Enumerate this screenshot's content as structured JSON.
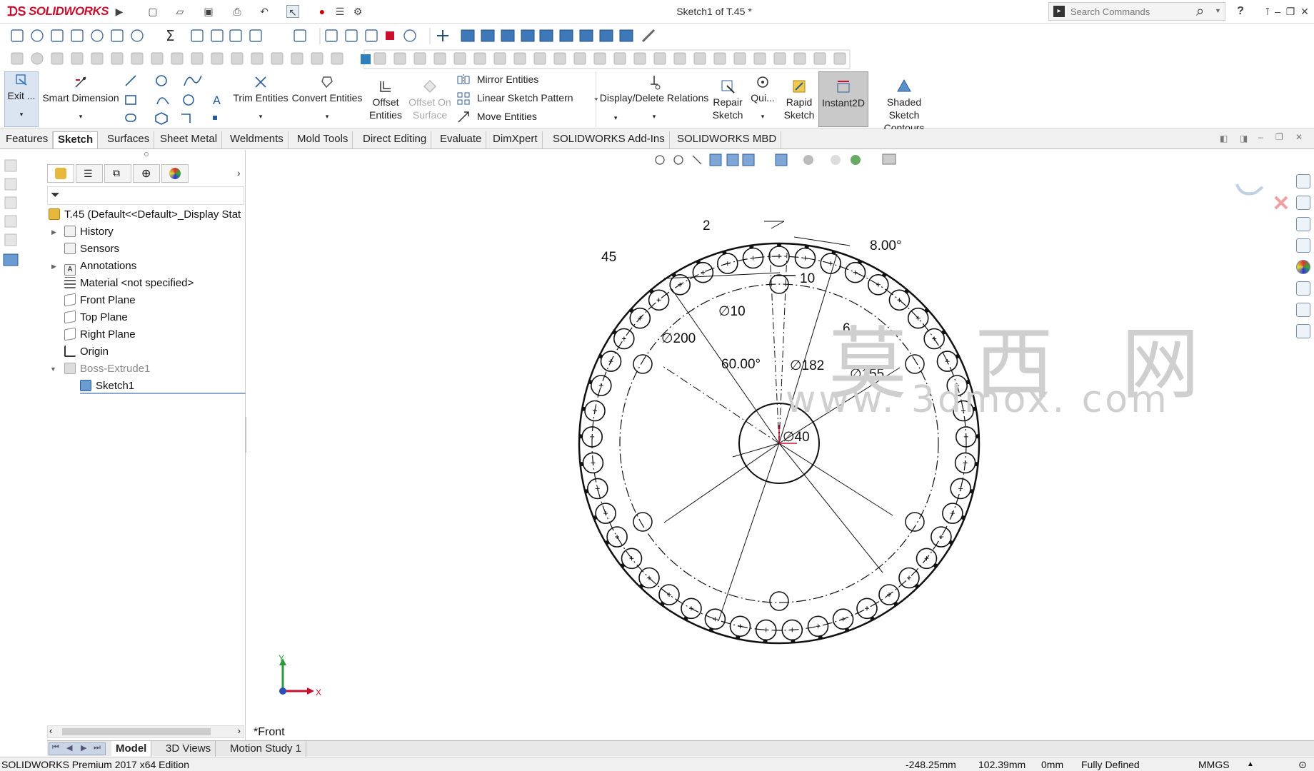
{
  "app": {
    "brand": "SOLIDWORKS",
    "document_title": "Sketch1 of T.45 *",
    "search_placeholder": "Search Commands",
    "help_label": "?",
    "accent": "#c8102e"
  },
  "command_manager": {
    "exit_sketch": "Exit ...",
    "smart_dimension": "Smart Dimension",
    "trim_entities": "Trim Entities",
    "convert_entities": "Convert Entities",
    "offset_entities_1": "Offset",
    "offset_entities_2": "Entities",
    "offset_on_surface_1": "Offset On",
    "offset_on_surface_2": "Surface",
    "mirror_entities": "Mirror Entities",
    "linear_sketch_pattern": "Linear Sketch Pattern",
    "move_entities": "Move Entities",
    "display_delete_relations": "Display/Delete Relations",
    "repair_sketch_1": "Repair",
    "repair_sketch_2": "Sketch",
    "quick_snaps": "Qui...",
    "rapid_sketch_1": "Rapid",
    "rapid_sketch_2": "Sketch",
    "instant2d": "Instant2D",
    "shaded_contours_1": "Shaded Sketch",
    "shaded_contours_2": "Contours"
  },
  "tabs": [
    "Features",
    "Sketch",
    "Surfaces",
    "Sheet Metal",
    "Weldments",
    "Mold Tools",
    "Direct Editing",
    "Evaluate",
    "DimXpert",
    "SOLIDWORKS Add-Ins",
    "SOLIDWORKS MBD"
  ],
  "tree": {
    "root": "T.45  (Default<<Default>_Display Stat",
    "items": [
      "History",
      "Sensors",
      "Annotations",
      "Material <not specified>",
      "Front Plane",
      "Top Plane",
      "Right Plane",
      "Origin",
      "Boss-Extrude1",
      "Sketch1"
    ]
  },
  "bottom_tabs": [
    "Model",
    "3D Views",
    "Motion Study 1"
  ],
  "view_label": "*Front",
  "status": {
    "edition": "SOLIDWORKS Premium 2017 x64 Edition",
    "x": "-248.25mm",
    "y": "102.39mm",
    "z": "0mm",
    "state": "Fully Defined",
    "units": "MMGS"
  },
  "sketch": {
    "dims": {
      "d_top": "2",
      "angle_small": "8.00°",
      "count": "45",
      "d_hole": "10",
      "dia_hole": "∅10",
      "dia_200": "∅200",
      "angle_60": "60.00°",
      "dia_182": "∅182",
      "dia_155": "∅155",
      "six": "6",
      "dia_40": "∅40"
    },
    "axis_x": "X",
    "axis_y": "Y"
  },
  "watermark": {
    "chars": "莫 西 网",
    "url": "www. 3dmox. com"
  }
}
